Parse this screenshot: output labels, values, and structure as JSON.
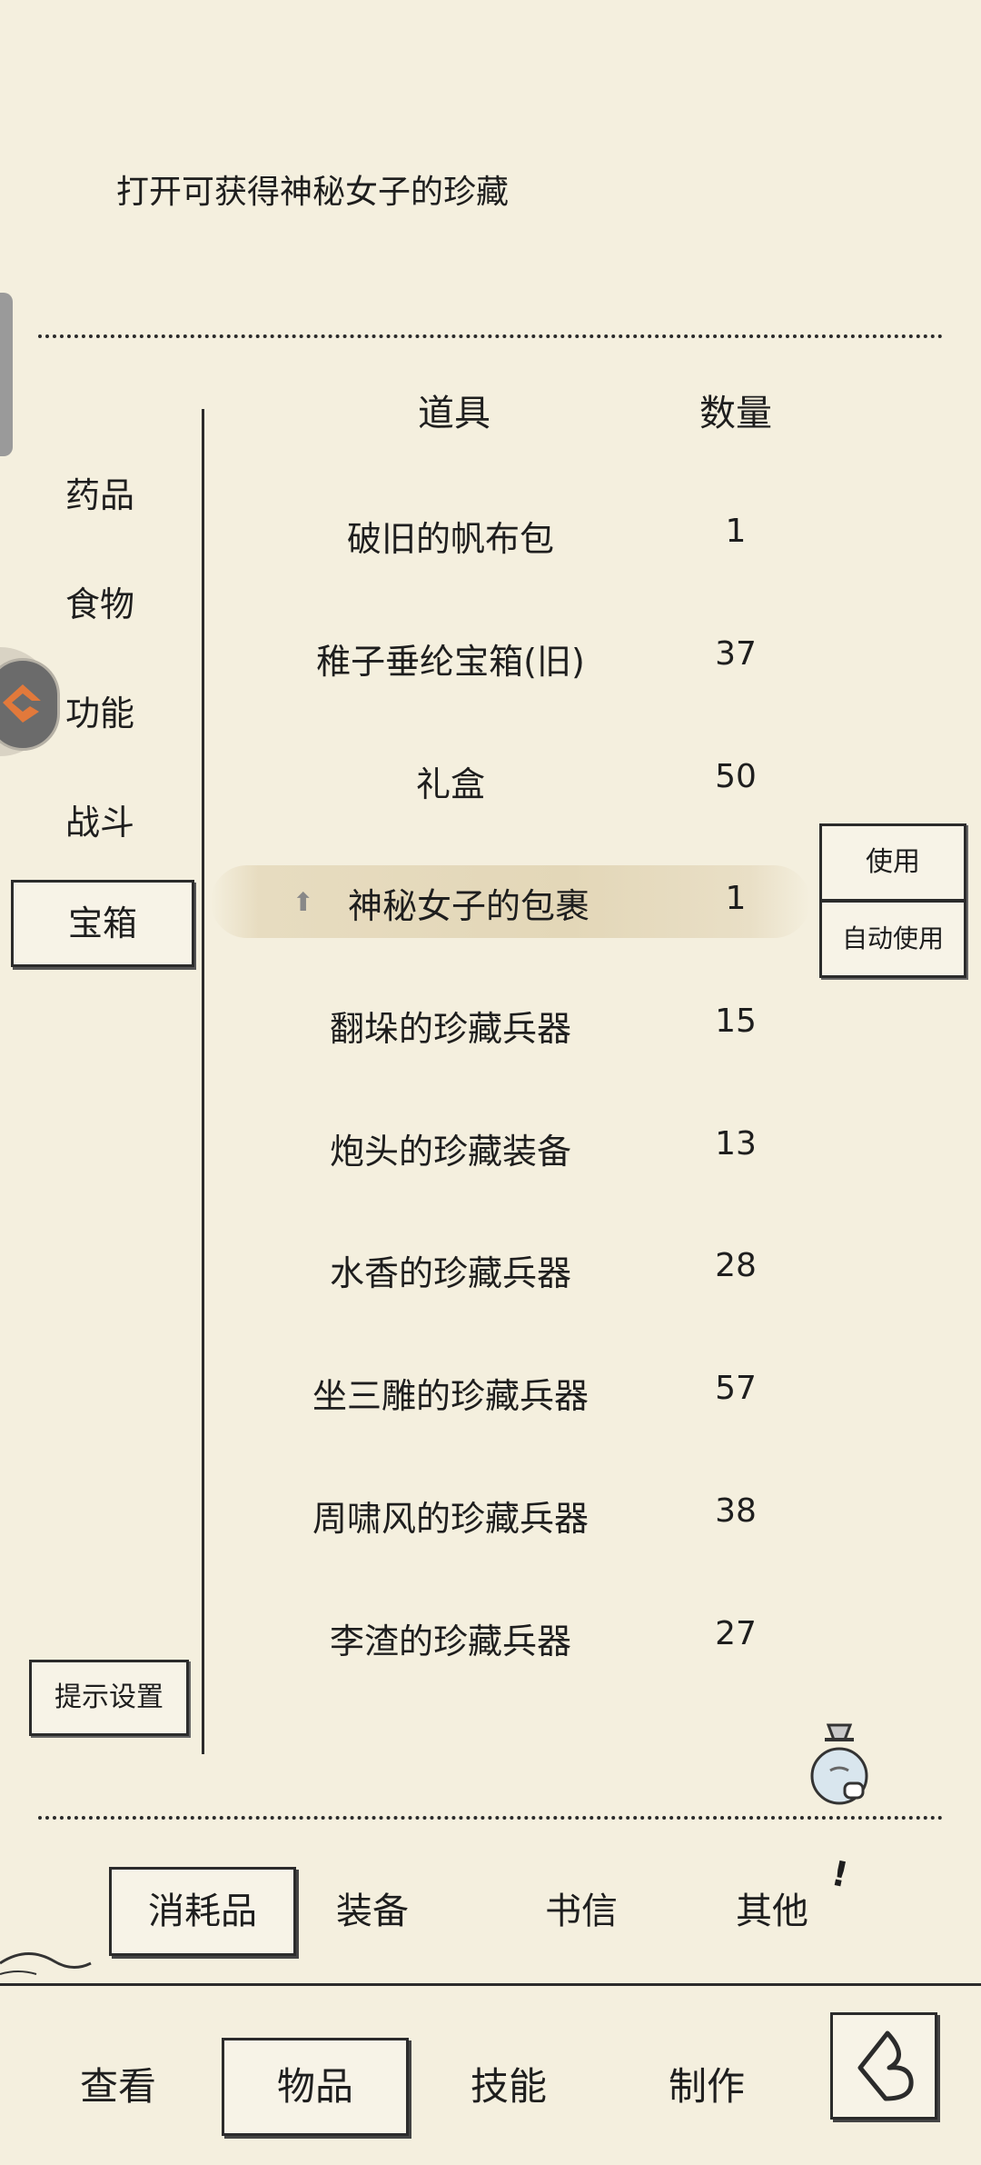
{
  "description": "打开可获得神秘女子的珍藏",
  "categories": [
    "药品",
    "食物",
    "功能",
    "战斗",
    "宝箱"
  ],
  "selected_category": "宝箱",
  "table": {
    "header_item": "道具",
    "header_qty": "数量",
    "rows": [
      {
        "name": "破旧的帆布包",
        "qty": "1"
      },
      {
        "name": "稚子垂纶宝箱(旧)",
        "qty": "37"
      },
      {
        "name": "礼盒",
        "qty": "50"
      },
      {
        "name": "神秘女子的包裹",
        "qty": "1"
      },
      {
        "name": "翻垛的珍藏兵器",
        "qty": "15"
      },
      {
        "name": "炮头的珍藏装备",
        "qty": "13"
      },
      {
        "name": "水香的珍藏兵器",
        "qty": "28"
      },
      {
        "name": "坐三雕的珍藏兵器",
        "qty": "57"
      },
      {
        "name": "周啸风的珍藏兵器",
        "qty": "38"
      },
      {
        "name": "李渣的珍藏兵器",
        "qty": "27"
      }
    ],
    "selected_row": "神秘女子的包裹"
  },
  "actions": {
    "use": "使用",
    "auto_use": "自动使用"
  },
  "tips_button": "提示设置",
  "subtabs": [
    "消耗品",
    "装备",
    "书信",
    "其他"
  ],
  "selected_subtab": "消耗品",
  "alert_mark": "!",
  "nav": [
    "查看",
    "物品",
    "技能",
    "制作"
  ],
  "selected_nav": "物品",
  "icons": {
    "pin": "pin-up-icon",
    "bag": "money-bag-icon",
    "back": "back-arrow-icon",
    "badge": "chevron-badge-icon"
  }
}
